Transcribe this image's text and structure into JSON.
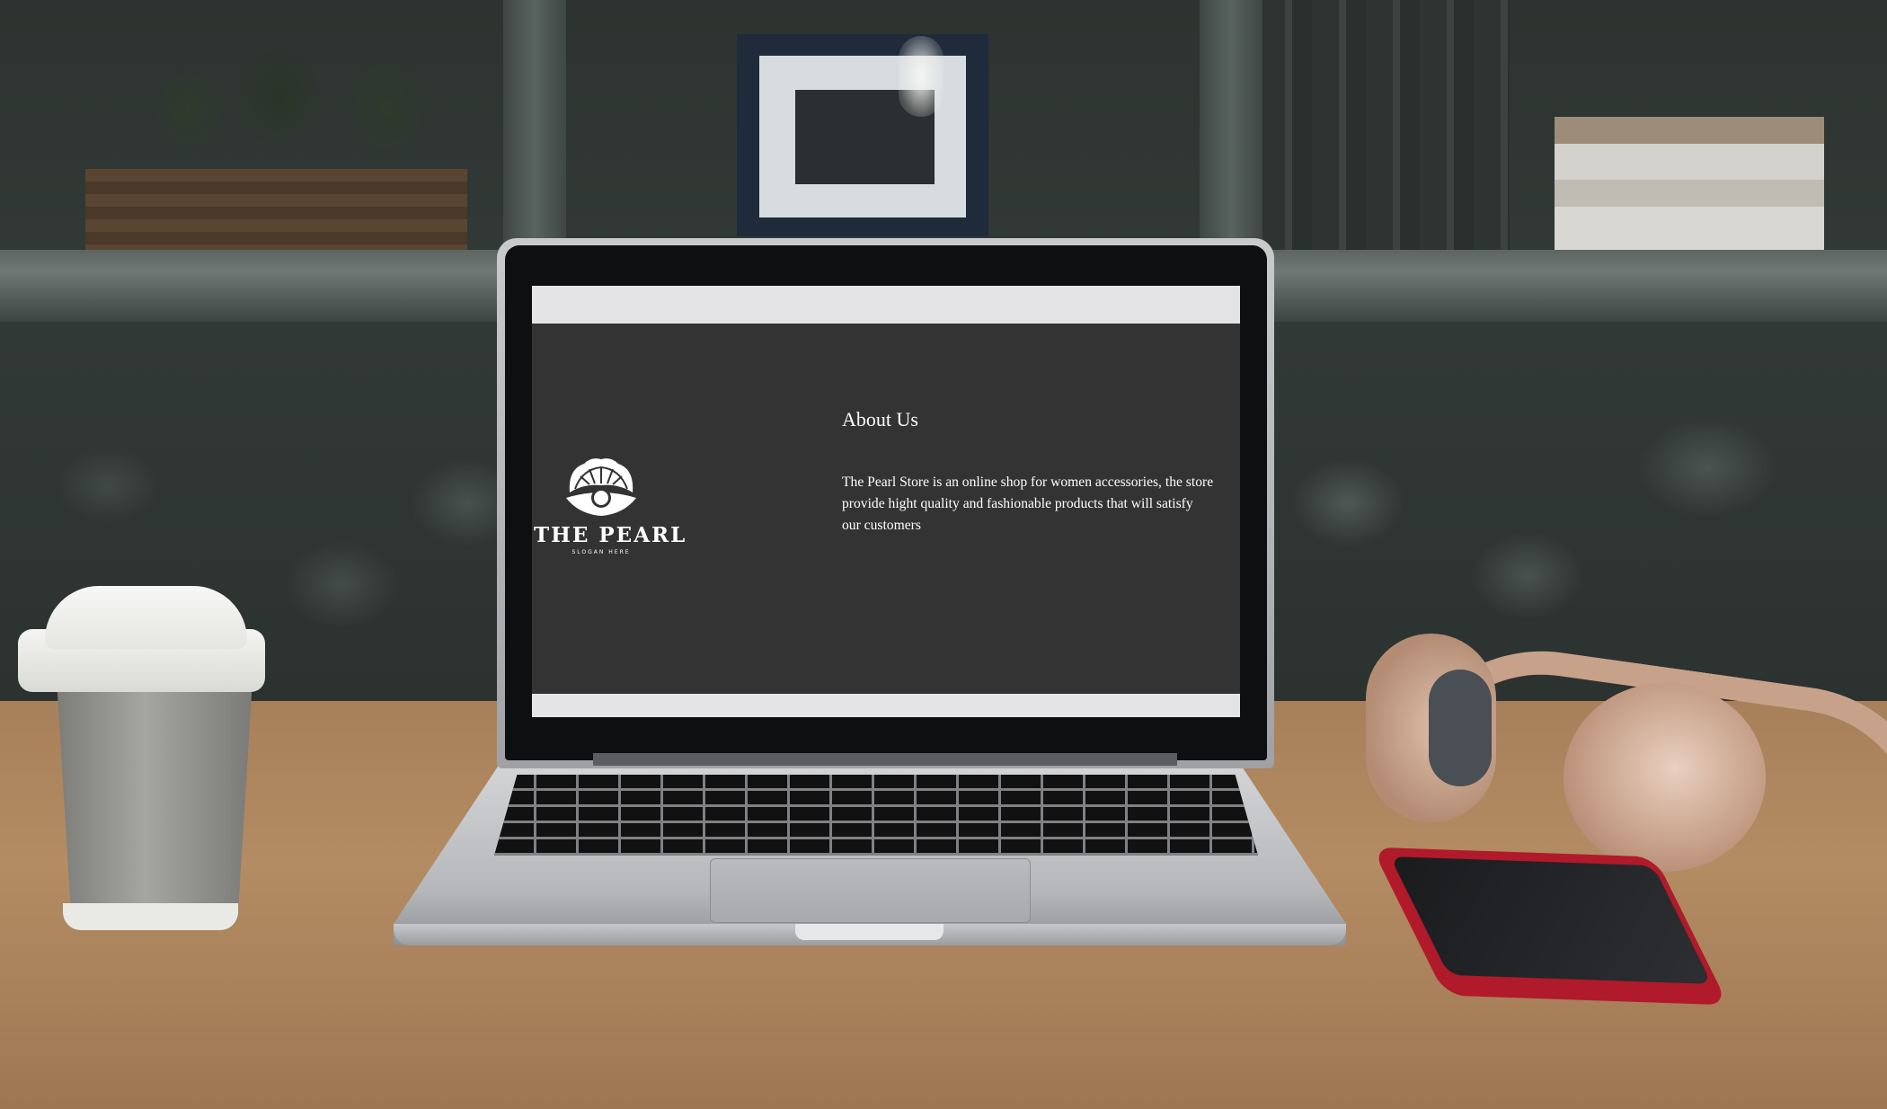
{
  "website": {
    "brand_name": "THE PEARL",
    "slogan": "SLOGAN HERE",
    "about_title": "About Us",
    "about_lines": [
      "The Pearl Store is an online shop for women accessories, the store",
      "provide hight quality and fashionable products that will satisfy",
      "our customers"
    ]
  },
  "icons": {
    "logo": "pearl-shell-icon"
  },
  "colors": {
    "page_background": "#333333",
    "bars": "#e4e4e6",
    "text": "#ffffff"
  }
}
